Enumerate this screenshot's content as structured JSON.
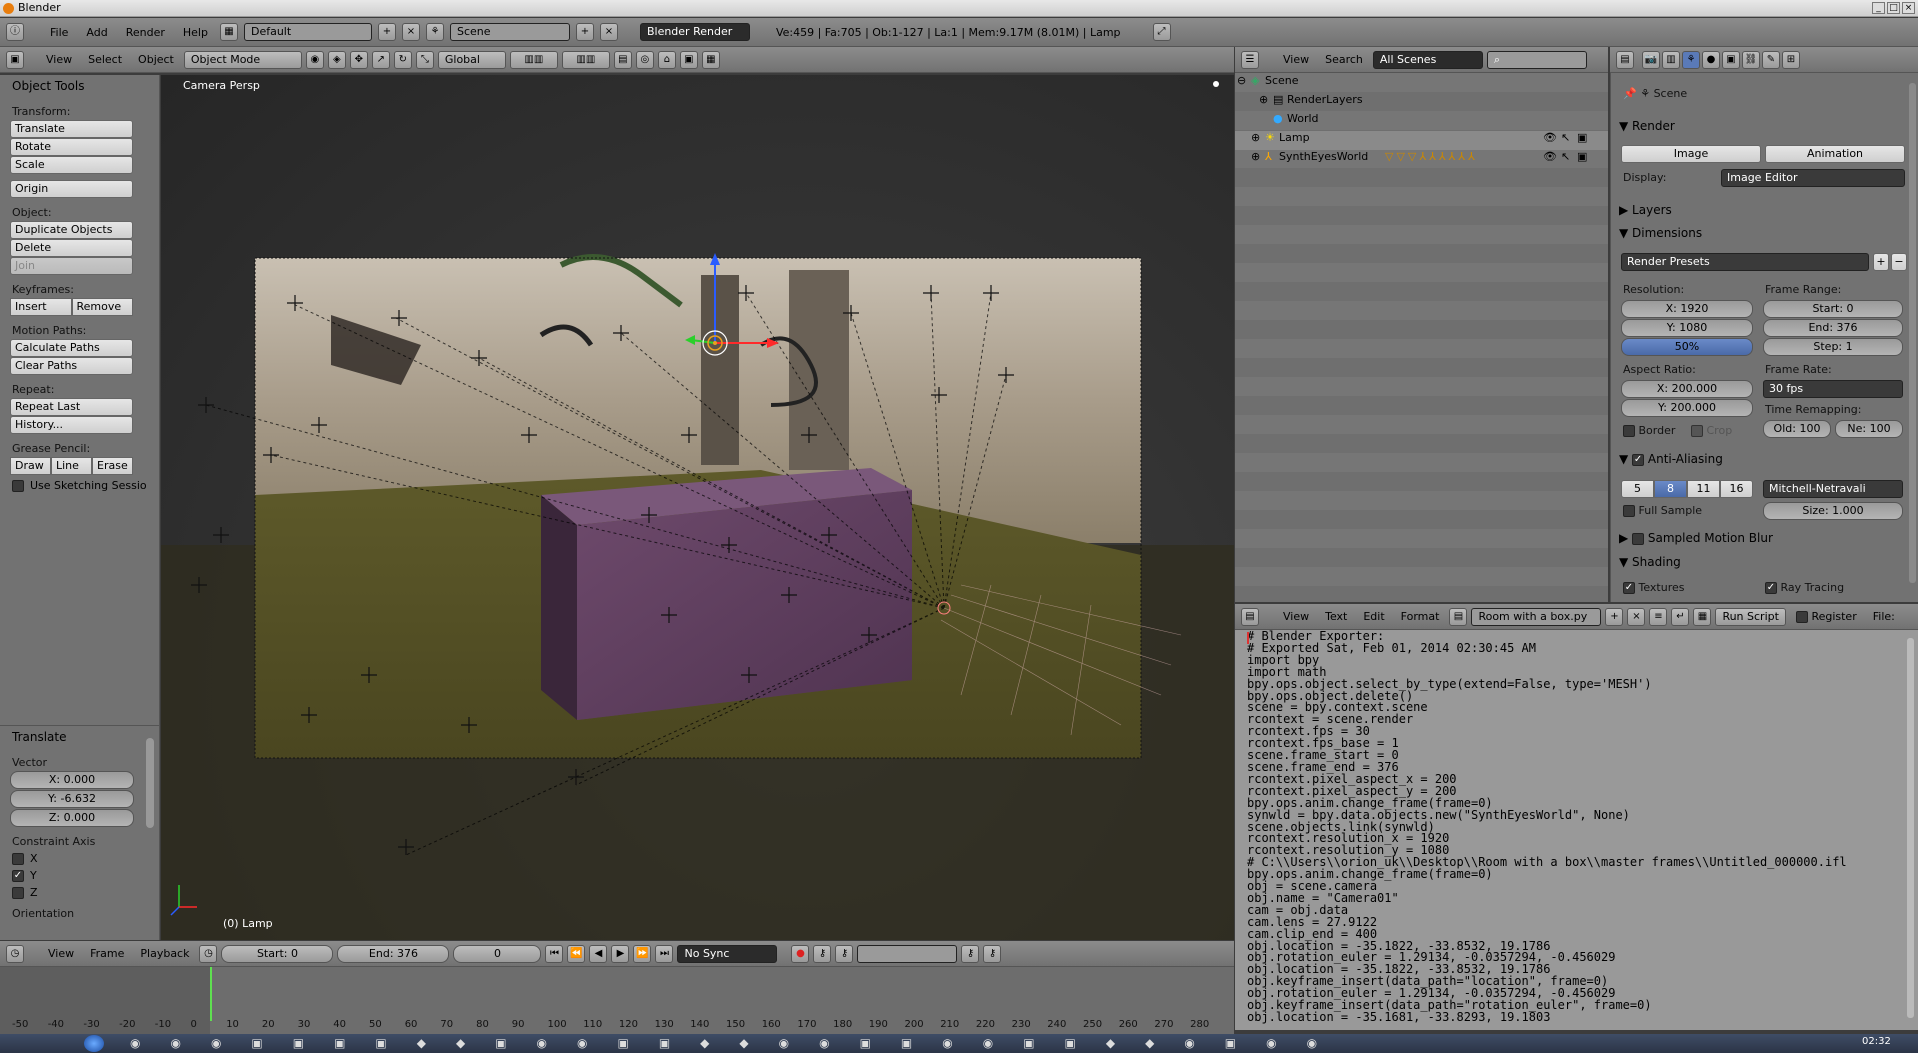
{
  "window": {
    "title": "Blender"
  },
  "info_header": {
    "menus": [
      "File",
      "Add",
      "Render",
      "Help"
    ],
    "layout": "Default",
    "scene": "Scene",
    "engine": "Blender Render",
    "stats": "Ve:459 | Fa:705 | Ob:1-127 | La:1 | Mem:9.17M (8.01M) | Lamp"
  },
  "view3d_header": {
    "menus": [
      "View",
      "Select",
      "Object"
    ],
    "mode": "Object Mode",
    "orientation": "Global"
  },
  "tool_panel": {
    "title": "Object Tools",
    "transform_label": "Transform:",
    "translate": "Translate",
    "rotate": "Rotate",
    "scale": "Scale",
    "origin": "Origin",
    "object_label": "Object:",
    "duplicate": "Duplicate Objects",
    "delete": "Delete",
    "join": "Join",
    "keyframes_label": "Keyframes:",
    "insert": "Insert",
    "remove": "Remove",
    "motion_label": "Motion Paths:",
    "calc_paths": "Calculate Paths",
    "clear_paths": "Clear Paths",
    "repeat_label": "Repeat:",
    "repeat_last": "Repeat Last",
    "history": "History...",
    "grease_label": "Grease Pencil:",
    "draw": "Draw",
    "line": "Line",
    "erase": "Erase",
    "sketching": "Use Sketching Sessio"
  },
  "operator_panel": {
    "title": "Translate",
    "vector_label": "Vector",
    "x": "X: 0.000",
    "y": "Y: -6.632",
    "z": "Z: 0.000",
    "constraint_label": "Constraint Axis",
    "cx": "X",
    "cy": "Y",
    "cz": "Z",
    "orientation_label": "Orientation"
  },
  "viewport": {
    "label": "Camera Persp",
    "object_label": "(0) Lamp"
  },
  "outliner": {
    "menus": [
      "View",
      "Search"
    ],
    "filter": "All Scenes",
    "items": [
      "Scene",
      "RenderLayers",
      "World",
      "Lamp",
      "SynthEyesWorld"
    ]
  },
  "properties": {
    "context": "Scene",
    "render": "Render",
    "image": "Image",
    "animation": "Animation",
    "display_label": "Display:",
    "display_value": "Image Editor",
    "layers": "Layers",
    "dimensions": "Dimensions",
    "presets": "Render Presets",
    "resolution_label": "Resolution:",
    "res_x": "X: 1920",
    "res_y": "Y: 1080",
    "res_pct": "50%",
    "frame_range_label": "Frame Range:",
    "start": "Start: 0",
    "end": "End: 376",
    "step": "Step: 1",
    "aspect_label": "Aspect Ratio:",
    "asp_x": "X: 200.000",
    "asp_y": "Y: 200.000",
    "frame_rate_label": "Frame Rate:",
    "fps": "30 fps",
    "time_remap_label": "Time Remapping:",
    "old": "Old: 100",
    "new": "Ne: 100",
    "border": "Border",
    "crop": "Crop",
    "anti_aliasing": "Anti-Aliasing",
    "aa_samples": [
      "5",
      "8",
      "11",
      "16"
    ],
    "aa_filter": "Mitchell-Netravali",
    "full_sample": "Full Sample",
    "size": "Size: 1.000",
    "motion_blur": "Sampled Motion Blur",
    "shading": "Shading",
    "textures": "Textures",
    "ray_tracing": "Ray Tracing"
  },
  "text_editor": {
    "menus": [
      "View",
      "Text",
      "Edit",
      "Format"
    ],
    "filename": "Room with a box.py",
    "run_script": "Run Script",
    "register": "Register",
    "file_label": "File:",
    "code": "# Blender Exporter:\n# Exported Sat, Feb 01, 2014 02:30:45 AM\nimport bpy\nimport math\nbpy.ops.object.select_by_type(extend=False, type='MESH')\nbpy.ops.object.delete()\nscene = bpy.context.scene\nrcontext = scene.render\nrcontext.fps = 30\nrcontext.fps_base = 1\nscene.frame_start = 0\nscene.frame_end = 376\nrcontext.pixel_aspect_x = 200\nrcontext.pixel_aspect_y = 200\nbpy.ops.anim.change_frame(frame=0)\nsynwld = bpy.data.objects.new(\"SynthEyesWorld\", None)\nscene.objects.link(synwld)\nrcontext.resolution_x = 1920\nrcontext.resolution_y = 1080\n# C:\\\\Users\\\\orion_uk\\\\Desktop\\\\Room with a box\\\\master frames\\\\Untitled_000000.ifl\nbpy.ops.anim.change_frame(frame=0)\nobj = scene.camera\nobj.name = \"Camera01\"\ncam = obj.data\ncam.lens = 27.9122\ncam.clip_end = 400\nobj.location = -35.1822, -33.8532, 19.1786\nobj.rotation_euler = 1.29134, -0.0357294, -0.456029\nobj.location = -35.1822, -33.8532, 19.1786\nobj.keyframe_insert(data_path=\"location\", frame=0)\nobj.rotation_euler = 1.29134, -0.0357294, -0.456029\nobj.keyframe_insert(data_path=\"rotation_euler\", frame=0)\nobj.location = -35.1681, -33.8293, 19.1803"
  },
  "timeline": {
    "menus": [
      "View",
      "Frame",
      "Playback"
    ],
    "start": "Start: 0",
    "end": "End: 376",
    "current": "0",
    "sync": "No Sync",
    "ticks": [
      "-50",
      "-40",
      "-30",
      "-20",
      "-10",
      "0",
      "10",
      "20",
      "30",
      "40",
      "50",
      "60",
      "70",
      "80",
      "90",
      "100",
      "110",
      "120",
      "130",
      "140",
      "150",
      "160",
      "170",
      "180",
      "190",
      "200",
      "210",
      "220",
      "230",
      "240",
      "250",
      "260",
      "270",
      "280"
    ]
  },
  "taskbar": {
    "clock": "02:32"
  }
}
